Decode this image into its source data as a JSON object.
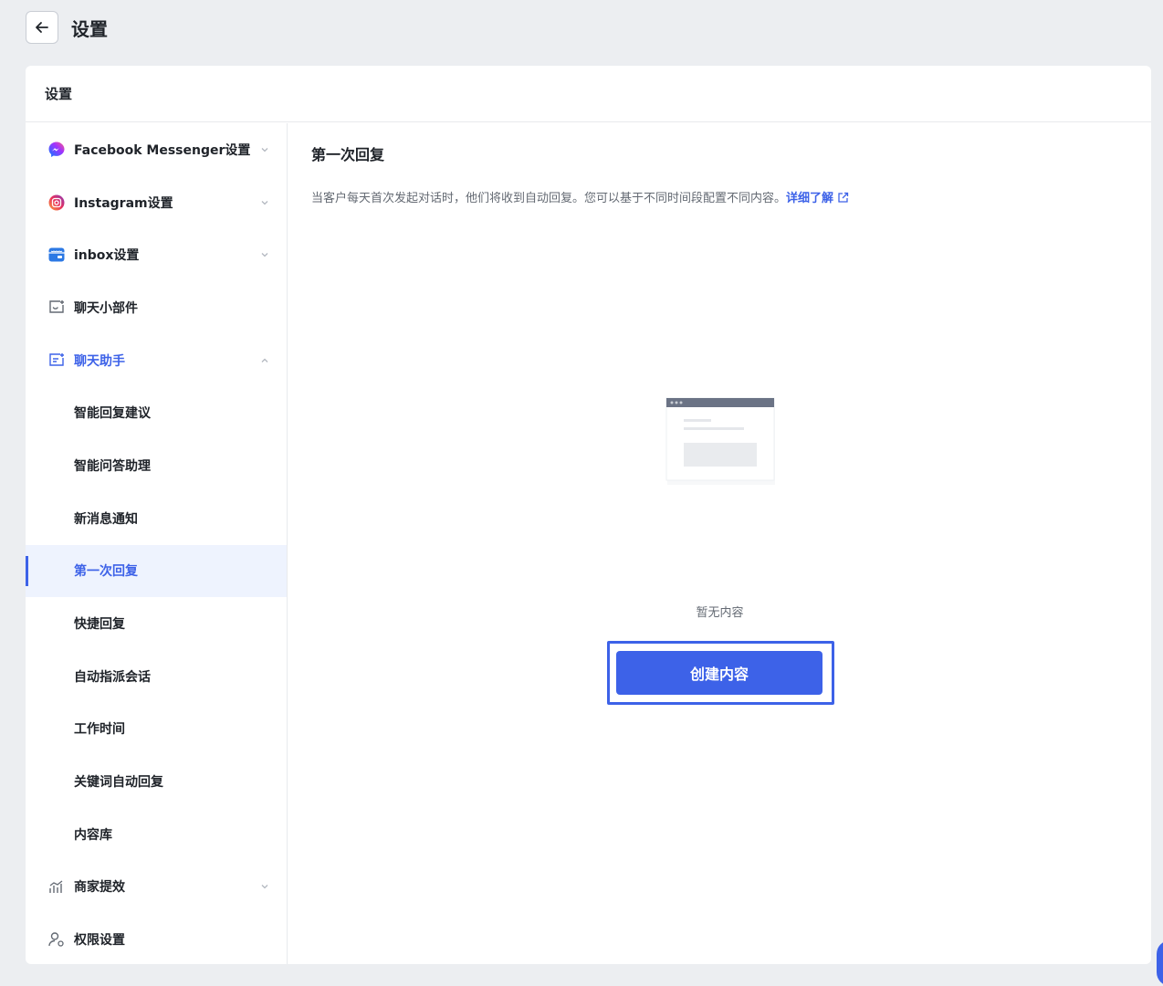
{
  "header": {
    "title": "设置",
    "back_icon": "arrow-left-icon"
  },
  "card": {
    "title": "设置"
  },
  "sidebar": {
    "items": [
      {
        "label": "Facebook Messenger设置",
        "icon": "messenger-icon",
        "chevron": "down"
      },
      {
        "label": "Instagram设置",
        "icon": "instagram-icon",
        "chevron": "down"
      },
      {
        "label": "inbox设置",
        "icon": "inbox-icon",
        "chevron": "down"
      },
      {
        "label": "聊天小部件",
        "icon": "chat-widget-icon"
      },
      {
        "label": "聊天助手",
        "icon": "chat-assistant-icon",
        "chevron": "up"
      },
      {
        "label": "智能回复建议"
      },
      {
        "label": "智能问答助理"
      },
      {
        "label": "新消息通知"
      },
      {
        "label": "第一次回复"
      },
      {
        "label": "快捷回复"
      },
      {
        "label": "自动指派会话"
      },
      {
        "label": "工作时间"
      },
      {
        "label": "关键词自动回复"
      },
      {
        "label": "内容库"
      },
      {
        "label": "商家提效",
        "icon": "chart-icon",
        "chevron": "down"
      },
      {
        "label": "权限设置",
        "icon": "user-settings-icon"
      }
    ]
  },
  "main": {
    "title": "第一次回复",
    "description": "当客户每天首次发起对话时，他们将收到自动回复。您可以基于不同时间段配置不同内容。",
    "learn_more": "详细了解",
    "empty_text": "暂无内容",
    "create_button": "创建内容"
  },
  "colors": {
    "accent": "#3d62e8",
    "background": "#eceef1"
  }
}
